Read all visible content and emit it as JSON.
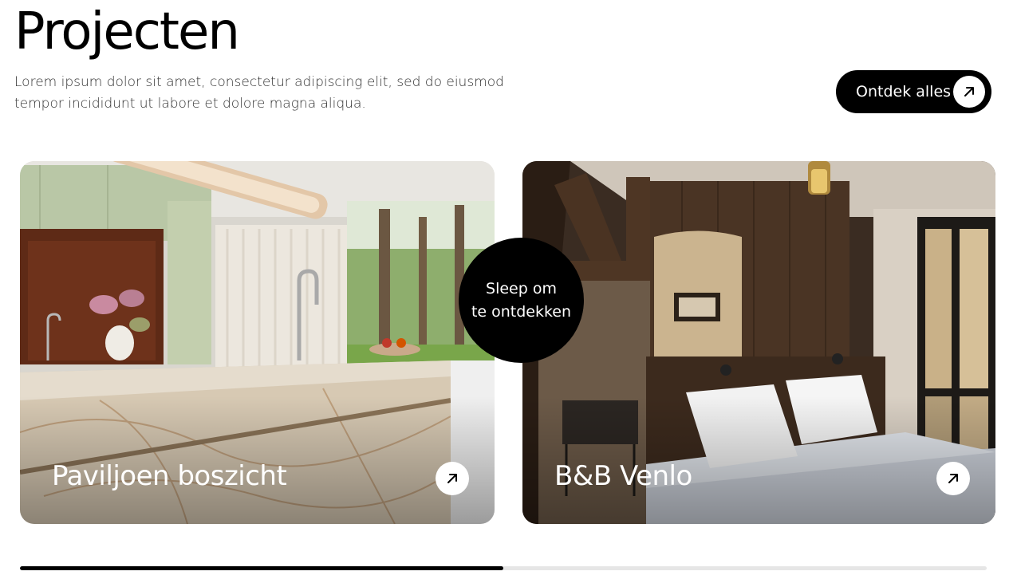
{
  "header": {
    "title": "Projecten",
    "intro_line1": "Lorem ipsum dolor sit amet, consectetur adipiscing elit, sed do eiusmod",
    "intro_line2": "tempor incididunt ut labore et dolore magna aliqua.",
    "cta_label": "Ontdek alles",
    "cta_icon": "arrow-up-right-icon"
  },
  "slider": {
    "drag_hint_line1": "Sleep om",
    "drag_hint_line2": "te ontdekken",
    "progress": 0.5,
    "cards": [
      {
        "title": "Paviljoen boszicht",
        "icon": "arrow-up-right-icon",
        "image": "kitchen-photo"
      },
      {
        "title": "B&B Venlo",
        "icon": "arrow-up-right-icon",
        "image": "bedroom-photo"
      }
    ]
  },
  "colors": {
    "accent": "#000000",
    "background": "#ffffff",
    "track": "#e6e6e6"
  }
}
